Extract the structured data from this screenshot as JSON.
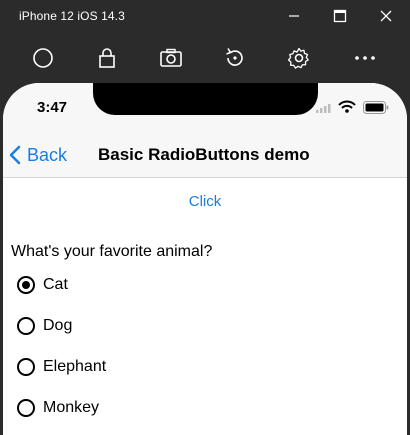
{
  "window": {
    "title": "iPhone 12 iOS 14.3"
  },
  "toolbar": {
    "icons": [
      "home-icon",
      "lock-icon",
      "screenshot-icon",
      "rotate-icon",
      "settings-icon",
      "more-icon"
    ]
  },
  "status_bar": {
    "time": "3:47"
  },
  "nav": {
    "back_label": "Back",
    "title": "Basic RadioButtons demo"
  },
  "content": {
    "button_label": "Click",
    "question": "What's your favorite animal?",
    "options": [
      {
        "label": "Cat",
        "selected": true
      },
      {
        "label": "Dog",
        "selected": false
      },
      {
        "label": "Elephant",
        "selected": false
      },
      {
        "label": "Monkey",
        "selected": false
      }
    ]
  },
  "colors": {
    "accent": "#1a7ee0",
    "chrome": "#2b2b2b"
  }
}
